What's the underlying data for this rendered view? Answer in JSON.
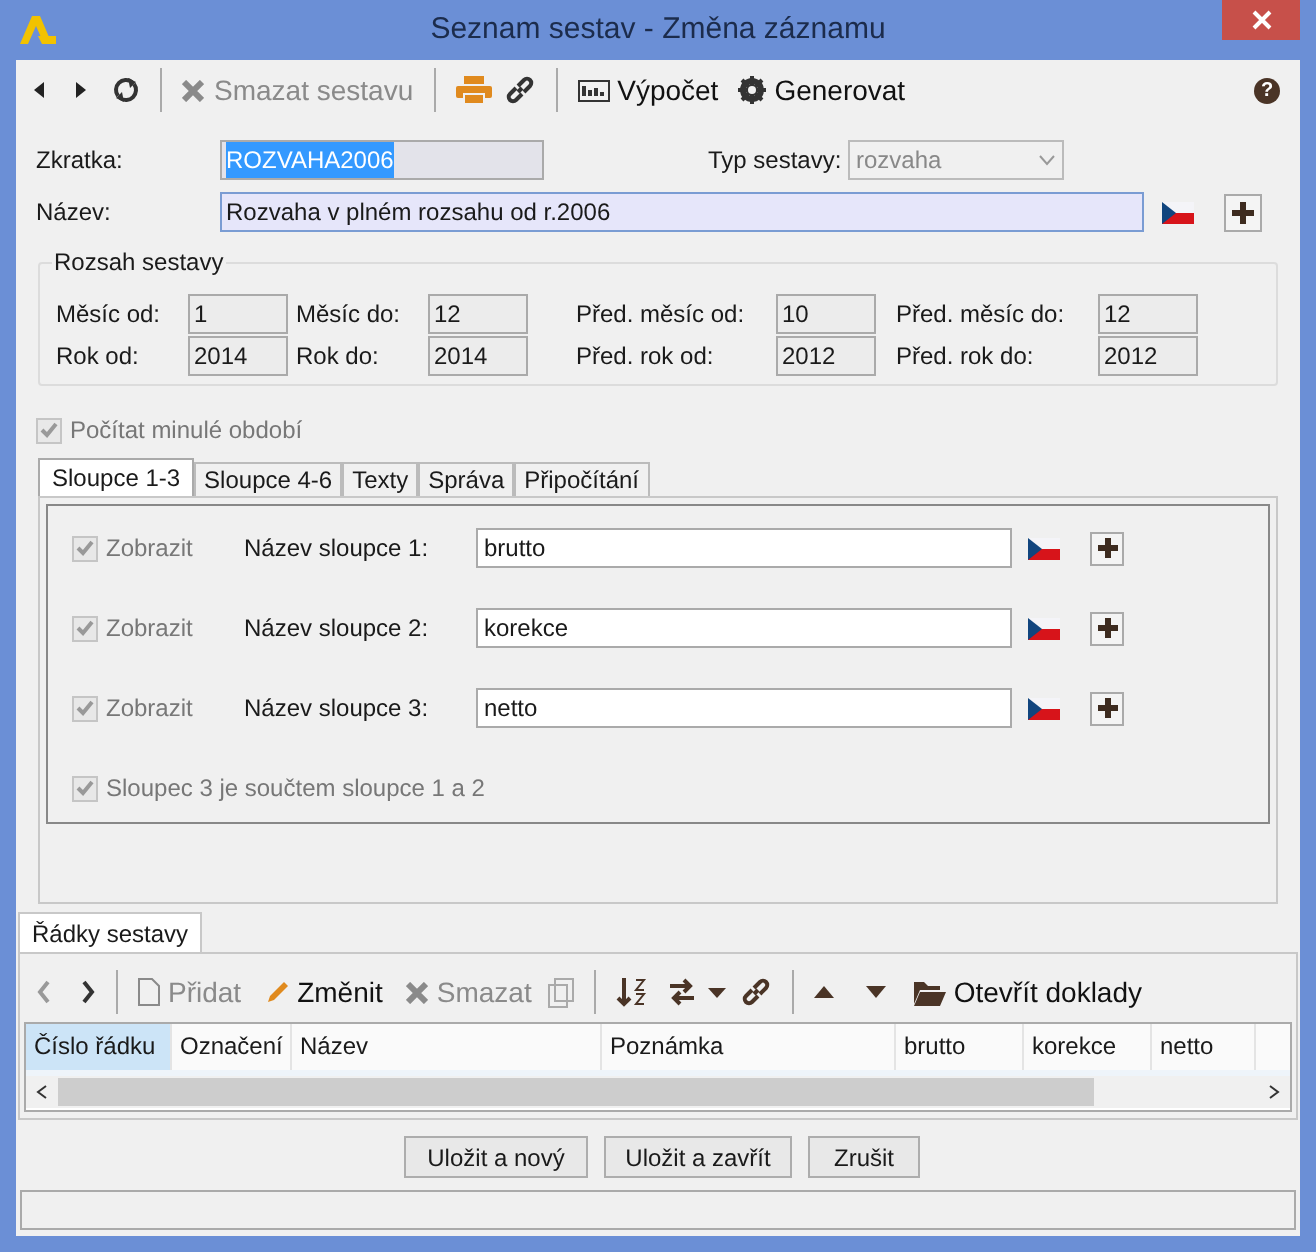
{
  "window": {
    "title": "Seznam sestav - Změna záznamu"
  },
  "toolbar": {
    "buttons": [
      {
        "label": "Smazat sestavu",
        "disabled": true
      },
      {
        "label": "Výpočet",
        "disabled": false
      },
      {
        "label": "Generovat",
        "disabled": false
      }
    ],
    "help": "?"
  },
  "form": {
    "code": {
      "label": "Zkratka:",
      "value": "ROZVAHA2006",
      "text_selected": true
    },
    "type": {
      "label": "Typ sestavy:",
      "value": "rozvaha",
      "disabled": true
    },
    "name": {
      "label": "Název:",
      "value": "Rozvaha v plném rozsahu od r.2006"
    }
  },
  "range": {
    "title": "Rozsah sestavy",
    "fields": [
      {
        "label": "Měsíc od:",
        "value": "1"
      },
      {
        "label": "Měsíc do:",
        "value": "12"
      },
      {
        "label": "Před. měsíc od:",
        "value": "10"
      },
      {
        "label": "Před. měsíc do:",
        "value": "12"
      },
      {
        "label": "Rok od:",
        "value": "2014"
      },
      {
        "label": "Rok do:",
        "value": "2014"
      },
      {
        "label": "Před. rok od:",
        "value": "2012"
      },
      {
        "label": "Před. rok do:",
        "value": "2012"
      }
    ]
  },
  "previous_period": {
    "label": "Počítat minulé období",
    "checked": true,
    "disabled": true
  },
  "tabs": [
    {
      "label": "Sloupce 1-3",
      "selected": true
    },
    {
      "label": "Sloupce 4-6",
      "selected": false
    },
    {
      "label": "Texty",
      "selected": false
    },
    {
      "label": "Správa",
      "selected": false
    },
    {
      "label": "Připočítání",
      "selected": false
    }
  ],
  "columns": [
    {
      "show_label": "Zobrazit",
      "checked": true,
      "label": "Název sloupce 1:",
      "value": "brutto"
    },
    {
      "show_label": "Zobrazit",
      "checked": true,
      "label": "Název sloupce 2:",
      "value": "korekce"
    },
    {
      "show_label": "Zobrazit",
      "checked": true,
      "label": "Název sloupce 3:",
      "value": "netto"
    }
  ],
  "sum_option": {
    "label": "Sloupec 3 je součtem sloupce 1 a 2",
    "checked": true,
    "disabled": true
  },
  "rows_panel": {
    "tab": {
      "label": "Řádky sestavy",
      "selected": true
    },
    "toolbar": [
      {
        "label": "Přidat",
        "disabled": true
      },
      {
        "label": "Změnit",
        "disabled": false
      },
      {
        "label": "Smazat",
        "disabled": true
      },
      {
        "label": "Otevřít doklady",
        "disabled": false
      }
    ],
    "table": {
      "columns": [
        {
          "label": "Číslo řádku",
          "selected": true
        },
        {
          "label": "Označení",
          "selected": false
        },
        {
          "label": "Název",
          "selected": false
        },
        {
          "label": "Poznámka",
          "selected": false
        },
        {
          "label": "brutto",
          "selected": false
        },
        {
          "label": "korekce",
          "selected": false
        },
        {
          "label": "netto",
          "selected": false
        }
      ]
    }
  },
  "buttons": [
    "Uložit a nový",
    "Uložit a zavřít",
    "Zrušit"
  ]
}
